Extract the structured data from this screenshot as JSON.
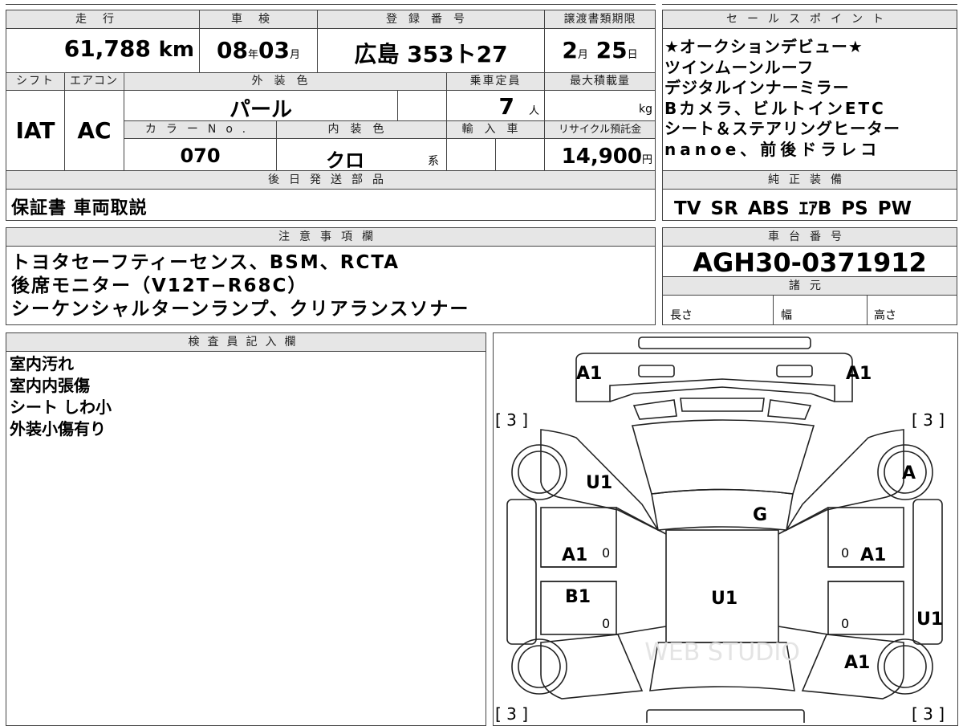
{
  "top": {
    "mileage_label": "走行",
    "mileage_value": "61,788",
    "mileage_unit": "km",
    "shaken_label": "車検",
    "shaken_year": "08",
    "shaken_year_unit": "年",
    "shaken_month": "03",
    "shaken_month_unit": "月",
    "reg_label": "登録番号",
    "reg_value": "広島 353ト27",
    "transfer_label": "譲渡書類期限",
    "transfer_month": "2",
    "transfer_month_unit": "月",
    "transfer_day": "25",
    "transfer_day_unit": "日"
  },
  "spec": {
    "shift_label": "シフト",
    "shift_value": "IAT",
    "ac_label": "エアコン",
    "ac_value": "AC",
    "exterior_label": "外装色",
    "exterior_value": "パール",
    "capacity_label": "乗車定員",
    "capacity_value": "7",
    "capacity_unit": "人",
    "maxload_label": "最大積載量",
    "maxload_unit": "kg",
    "colorno_label": "カラーNo.",
    "colorno_value": "070",
    "interior_label": "内装色",
    "interior_value": "クロ",
    "interior_unit": "系",
    "import_label": "輸入車",
    "recycle_label": "リサイクル預託金",
    "recycle_value": "14,900",
    "recycle_unit": "円"
  },
  "later": {
    "label": "後日発送部品",
    "value": "保証書 車両取説"
  },
  "sales": {
    "label": "セールスポイント",
    "lines": [
      "★オークションデビュー★",
      "ツインムーンルーフ",
      "デジタルインナーミラー",
      "Bカメラ、ビルトインETC",
      "シート＆ステアリングヒーター",
      "nanoe、前後ドラレコ"
    ]
  },
  "equipment": {
    "label": "純正装備",
    "items": [
      "TV",
      "SR",
      "ABS",
      "ｴｱB",
      "PS",
      "PW"
    ]
  },
  "notes": {
    "label": "注意事項欄",
    "lines": [
      "トヨタセーフティーセンス、BSM、RCTA",
      "後席モニター（V12T−R68C）",
      "シーケンシャルターンランプ、クリアランスソナー"
    ]
  },
  "chassis": {
    "label": "車台番号",
    "value": "AGH30-0371912"
  },
  "specs": {
    "label": "諸元",
    "length": "長さ",
    "width": "幅",
    "height": "高さ"
  },
  "inspector": {
    "label": "検査員記入欄",
    "lines": [
      "室内汚れ",
      "室内内張傷",
      "シート しわ小",
      "外装小傷有り"
    ]
  },
  "diagram": {
    "marks": [
      "A1",
      "A1",
      "U1",
      "A",
      "G",
      "A1",
      "A1",
      "B1",
      "U1",
      "U1",
      "A1"
    ],
    "brackets": [
      "[ 3 ]",
      "[ 3 ]",
      "[ 3 ]",
      "[ 3 ]"
    ],
    "zeros": [
      "0",
      "0",
      "0",
      "0"
    ],
    "watermark": "WEB STUDIO"
  }
}
